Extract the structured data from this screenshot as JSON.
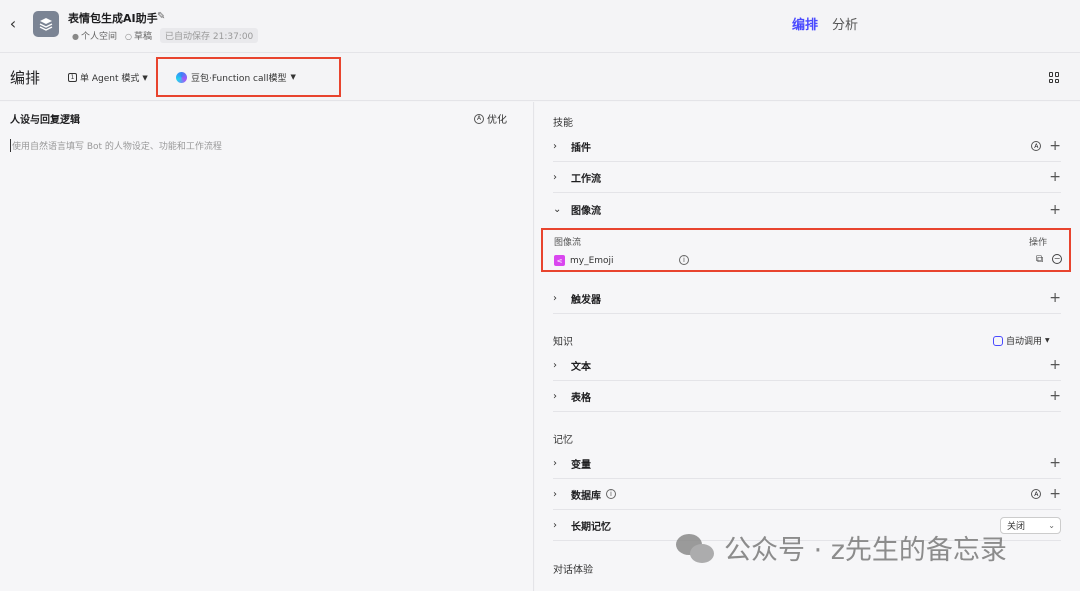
{
  "header": {
    "title": "表情包生成AI助手",
    "space": "个人空间",
    "status": "草稿",
    "autosave": "已自动保存 21:37:00",
    "tabs": [
      {
        "label": "编排",
        "active": true
      },
      {
        "label": "分析",
        "active": false
      }
    ]
  },
  "toolbar": {
    "title": "编排",
    "agent_mode": "单 Agent 模式",
    "model": "豆包·Function call模型"
  },
  "left": {
    "title": "人设与回复逻辑",
    "optimize_label": "优化",
    "placeholder": "使用自然语言填写 Bot 的人物设定、功能和工作流程"
  },
  "right": {
    "skills_label": "技能",
    "skills": [
      {
        "label": "插件"
      },
      {
        "label": "工作流"
      },
      {
        "label": "图像流"
      },
      {
        "label": "触发器"
      }
    ],
    "image_flow_panel": {
      "header": "图像流",
      "op_header": "操作",
      "item_name": "my_Emoji"
    },
    "knowledge_label": "知识",
    "auto_call": "自动调用",
    "knowledge": [
      {
        "label": "文本"
      },
      {
        "label": "表格"
      }
    ],
    "memory_label": "记忆",
    "memory": [
      {
        "label": "变量"
      },
      {
        "label": "数据库"
      },
      {
        "label": "长期记忆"
      }
    ],
    "long_memory_value": "关闭",
    "dialog_label": "对话体验"
  },
  "watermark": "公众号 · z先生的备忘录",
  "colors": {
    "accent": "#4a4aff",
    "highlight_border": "#e8442e",
    "flow_icon": "#d946ef"
  }
}
